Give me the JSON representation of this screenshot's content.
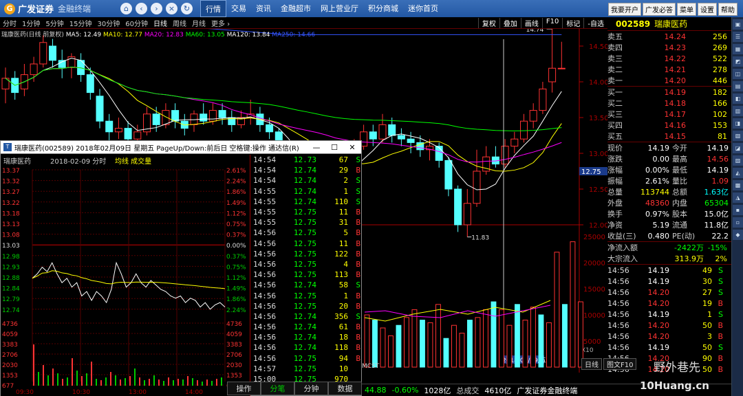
{
  "app": {
    "logo_main": "广发证券",
    "logo_sub": "金融终端"
  },
  "topnav": [
    "行情",
    "交易",
    "资讯",
    "金融超市",
    "网上营业厅",
    "积分商城",
    "迷你首页"
  ],
  "topnav_active": 0,
  "top_right": [
    "我要开户",
    "广发必答",
    "菜单",
    "设置",
    "帮助"
  ],
  "periods": [
    "分时",
    "1分钟",
    "5分钟",
    "15分钟",
    "30分钟",
    "60分钟",
    "日线",
    "周线",
    "月线",
    "更多 ›"
  ],
  "period_active": 6,
  "chart_tools": [
    "复权",
    "叠加",
    "画线",
    "F10",
    "标记",
    "-自选"
  ],
  "stock": {
    "code": "002589",
    "name": "瑞康医药"
  },
  "stock_line": {
    "title": "瑞康医药(日线 前复权)",
    "ma": [
      {
        "label": "MA5: 12.49",
        "color": "#ffffff"
      },
      {
        "label": "MA10: 12.77",
        "color": "#ffff00"
      },
      {
        "label": "MA20: 12.83",
        "color": "#ff00ff"
      },
      {
        "label": "MA60: 13.05",
        "color": "#00ff00"
      },
      {
        "label": "MA120: 13.84",
        "color": "#ffffff"
      },
      {
        "label": "MA250: 14.66",
        "color": "#3355ff"
      }
    ]
  },
  "price_axis": [
    "15.00",
    "14.50",
    "14.00",
    "13.50",
    "13.00",
    "12.50",
    "12.00"
  ],
  "price_current": "12.75",
  "vol_axis": [
    "25000",
    "20000",
    "15000",
    "10000",
    "5000"
  ],
  "annot_high": "14.74",
  "annot_low": "11.83",
  "date_label": "2018/02/09/五",
  "x_tick_2": "2",
  "x10_label": "X10",
  "mcst_label": "MCST",
  "right_bottom_tabs": [
    "日线",
    "图文F10"
  ],
  "quote": {
    "sell": [
      {
        "label": "卖五",
        "price": "14.24",
        "vol": "256"
      },
      {
        "label": "卖四",
        "price": "14.23",
        "vol": "269"
      },
      {
        "label": "卖三",
        "price": "14.22",
        "vol": "522"
      },
      {
        "label": "卖二",
        "price": "14.21",
        "vol": "278"
      },
      {
        "label": "卖一",
        "price": "14.20",
        "vol": "446"
      }
    ],
    "buy": [
      {
        "label": "买一",
        "price": "14.19",
        "vol": "182"
      },
      {
        "label": "买二",
        "price": "14.18",
        "vol": "166"
      },
      {
        "label": "买三",
        "price": "14.17",
        "vol": "102"
      },
      {
        "label": "买四",
        "price": "14.16",
        "vol": "153"
      },
      {
        "label": "买五",
        "price": "14.15",
        "vol": "81"
      }
    ],
    "stats": [
      {
        "l1": "现价",
        "v1": "14.19",
        "c1": "#ffffff",
        "l2": "今开",
        "v2": "14.19",
        "c2": "#ffffff"
      },
      {
        "l1": "涨跌",
        "v1": "0.00",
        "c1": "#ffffff",
        "l2": "最高",
        "v2": "14.56",
        "c2": "#ff3333"
      },
      {
        "l1": "涨幅",
        "v1": "0.00%",
        "c1": "#ffffff",
        "l2": "最低",
        "v2": "14.19",
        "c2": "#ffffff"
      },
      {
        "l1": "振幅",
        "v1": "2.61%",
        "c1": "#ffffff",
        "l2": "量比",
        "v2": "1.09",
        "c2": "#ff3333"
      },
      {
        "l1": "总量",
        "v1": "113744",
        "c1": "#ffff00",
        "l2": "总额",
        "v2": "1.63亿",
        "c2": "#00ffff"
      },
      {
        "l1": "外盘",
        "v1": "48360",
        "c1": "#ff3333",
        "l2": "内盘",
        "v2": "65304",
        "c2": "#00ff00"
      },
      {
        "l1": "换手",
        "v1": "0.97%",
        "c1": "#ffffff",
        "l2": "股本",
        "v2": "15.0亿",
        "c2": "#ffffff"
      },
      {
        "l1": "净资",
        "v1": "5.19",
        "c1": "#ffffff",
        "l2": "流通",
        "v2": "11.8亿",
        "c2": "#ffffff"
      },
      {
        "l1": "收益(三)",
        "v1": "0.480",
        "c1": "#ffffff",
        "l2": "PE(动)",
        "v2": "22.2",
        "c2": "#ffffff"
      }
    ],
    "flow": [
      {
        "label": "净流入额",
        "v": "-2422万",
        "p": "-15%",
        "c": "#00ff00"
      },
      {
        "label": "大宗流入",
        "v": "313.9万",
        "p": "2%",
        "c": "#ffff00"
      }
    ],
    "ticks": [
      {
        "t": "14:56",
        "p": "14.19",
        "v": "49",
        "s": "S",
        "pc": "#ffffff",
        "sc": "#00ff00"
      },
      {
        "t": "14:56",
        "p": "14.19",
        "v": "30",
        "s": "S",
        "pc": "#ffffff",
        "sc": "#00ff00"
      },
      {
        "t": "14:56",
        "p": "14.20",
        "v": "27",
        "s": "S",
        "pc": "#ff3333",
        "sc": "#00ff00"
      },
      {
        "t": "14:56",
        "p": "14.20",
        "v": "19",
        "s": "B",
        "pc": "#ff3333",
        "sc": "#ff3333"
      },
      {
        "t": "14:56",
        "p": "14.19",
        "v": "1",
        "s": "S",
        "pc": "#ffffff",
        "sc": "#00ff00"
      },
      {
        "t": "14:56",
        "p": "14.20",
        "v": "50",
        "s": "B",
        "pc": "#ff3333",
        "sc": "#ff3333"
      },
      {
        "t": "14:56",
        "p": "14.20",
        "v": "3",
        "s": "B",
        "pc": "#ff3333",
        "sc": "#ff3333"
      },
      {
        "t": "14:56",
        "p": "14.19",
        "v": "50",
        "s": "S",
        "pc": "#ffffff",
        "sc": "#00ff00"
      },
      {
        "t": "14:56",
        "p": "14.20",
        "v": "90",
        "s": "B",
        "pc": "#ff3333",
        "sc": "#ff3333"
      },
      {
        "t": "14:56",
        "p": "14.20",
        "v": "50",
        "s": "B",
        "pc": "#ff3333",
        "sc": "#ff3333"
      }
    ]
  },
  "popup": {
    "title": "瑞康医药(002589) 2018年02月09日 星期五 PageUp/Down:前后日 空格键:操作 通达信(R)",
    "sub_name": "瑞康医药",
    "sub_date": "2018-02-09 分时",
    "sub_legend": "均线 成交量",
    "price_labels": [
      "13.37",
      "13.32",
      "13.27",
      "13.22",
      "13.18",
      "13.13",
      "13.08",
      "13.03",
      "12.98",
      "12.93",
      "12.88",
      "12.84",
      "12.79",
      "12.74"
    ],
    "pct_labels": [
      "2.61%",
      "2.24%",
      "1.86%",
      "1.49%",
      "1.12%",
      "0.75%",
      "0.37%",
      "0.00%",
      "0.37%",
      "0.75%",
      "1.12%",
      "1.49%",
      "1.86%",
      "2.24%"
    ],
    "vol_labels": [
      "4736",
      "4059",
      "3383",
      "2706",
      "2030",
      "1353",
      "677"
    ],
    "time_labels": [
      "09:30",
      "10:30",
      "13:00",
      "14:00"
    ],
    "ticks": [
      {
        "t": "14:54",
        "p": "12.73",
        "v": "67",
        "s": "S"
      },
      {
        "t": "14:54",
        "p": "12.74",
        "v": "29",
        "s": "B"
      },
      {
        "t": "14:54",
        "p": "12.74",
        "v": "2",
        "s": "S"
      },
      {
        "t": "14:55",
        "p": "12.74",
        "v": "1",
        "s": "S"
      },
      {
        "t": "14:55",
        "p": "12.74",
        "v": "110",
        "s": "S"
      },
      {
        "t": "14:55",
        "p": "12.75",
        "v": "11",
        "s": "B"
      },
      {
        "t": "14:55",
        "p": "12.75",
        "v": "31",
        "s": "B"
      },
      {
        "t": "14:56",
        "p": "12.75",
        "v": "5",
        "s": "B"
      },
      {
        "t": "14:56",
        "p": "12.75",
        "v": "11",
        "s": "B"
      },
      {
        "t": "14:56",
        "p": "12.75",
        "v": "122",
        "s": "B"
      },
      {
        "t": "14:56",
        "p": "12.75",
        "v": "4",
        "s": "B"
      },
      {
        "t": "14:56",
        "p": "12.75",
        "v": "113",
        "s": "B"
      },
      {
        "t": "14:56",
        "p": "12.74",
        "v": "58",
        "s": "S"
      },
      {
        "t": "14:56",
        "p": "12.75",
        "v": "1",
        "s": "B"
      },
      {
        "t": "14:56",
        "p": "12.75",
        "v": "20",
        "s": "B"
      },
      {
        "t": "14:56",
        "p": "12.74",
        "v": "356",
        "s": "S"
      },
      {
        "t": "14:56",
        "p": "12.74",
        "v": "61",
        "s": "B"
      },
      {
        "t": "14:56",
        "p": "12.74",
        "v": "18",
        "s": "B"
      },
      {
        "t": "14:56",
        "p": "12.74",
        "v": "118",
        "s": "B"
      },
      {
        "t": "14:56",
        "p": "12.75",
        "v": "94",
        "s": "B"
      },
      {
        "t": "14:57",
        "p": "12.75",
        "v": "10",
        "s": ""
      },
      {
        "t": "15:00",
        "p": "12.75",
        "v": "970",
        "s": ""
      }
    ],
    "tabs": [
      "操作",
      "分笔",
      "分钟",
      "数据"
    ],
    "tab_active": 1
  },
  "bottom_bar": {
    "v1": "44.88",
    "v2": "-0.60%",
    "v3": "1028亿",
    "l4": "总成交",
    "v4": "4610亿",
    "broker": "广发证券金融终端"
  },
  "watermark": {
    "t1": "野外巷先",
    "t2": "10Huang.cn"
  },
  "chart_data": {
    "type": "candlestick",
    "days": [
      {
        "o": 13.9,
        "c": 14.05,
        "h": 14.2,
        "l": 13.7
      },
      {
        "o": 14.05,
        "c": 13.85,
        "h": 14.15,
        "l": 13.75
      },
      {
        "o": 13.9,
        "c": 14.1,
        "h": 14.25,
        "l": 13.8
      },
      {
        "o": 14.1,
        "c": 14.25,
        "h": 14.35,
        "l": 14.0
      },
      {
        "o": 14.25,
        "c": 14.55,
        "h": 14.65,
        "l": 14.2
      },
      {
        "o": 14.5,
        "c": 14.3,
        "h": 14.6,
        "l": 14.2
      },
      {
        "o": 14.3,
        "c": 14.2,
        "h": 14.45,
        "l": 14.05
      },
      {
        "o": 14.2,
        "c": 14.35,
        "h": 14.4,
        "l": 14.05
      },
      {
        "o": 14.3,
        "c": 14.1,
        "h": 14.4,
        "l": 14.0
      },
      {
        "o": 14.1,
        "c": 13.85,
        "h": 14.2,
        "l": 13.75
      },
      {
        "o": 13.8,
        "c": 13.45,
        "h": 13.9,
        "l": 13.35
      },
      {
        "o": 13.45,
        "c": 13.3,
        "h": 13.55,
        "l": 13.15
      },
      {
        "o": 13.3,
        "c": 13.35,
        "h": 13.5,
        "l": 13.2
      },
      {
        "o": 13.35,
        "c": 13.2,
        "h": 13.45,
        "l": 13.1
      },
      {
        "o": 13.2,
        "c": 13.3,
        "h": 13.4,
        "l": 13.1
      },
      {
        "o": 13.3,
        "c": 13.55,
        "h": 13.65,
        "l": 13.25
      },
      {
        "o": 13.55,
        "c": 13.4,
        "h": 13.65,
        "l": 13.3
      },
      {
        "o": 13.4,
        "c": 13.6,
        "h": 13.7,
        "l": 13.35
      },
      {
        "o": 13.6,
        "c": 13.45,
        "h": 13.7,
        "l": 13.35
      },
      {
        "o": 13.45,
        "c": 13.35,
        "h": 13.55,
        "l": 13.25
      },
      {
        "o": 13.4,
        "c": 13.55,
        "h": 13.6,
        "l": 13.3
      },
      {
        "o": 13.55,
        "c": 13.45,
        "h": 13.7,
        "l": 13.4
      },
      {
        "o": 13.45,
        "c": 13.6,
        "h": 13.7,
        "l": 13.4
      },
      {
        "o": 13.6,
        "c": 13.5,
        "h": 13.7,
        "l": 13.4
      },
      {
        "o": 13.5,
        "c": 13.4,
        "h": 13.6,
        "l": 13.3
      },
      {
        "o": 13.4,
        "c": 13.5,
        "h": 13.6,
        "l": 13.35
      },
      {
        "o": 13.5,
        "c": 13.55,
        "h": 13.75,
        "l": 13.4
      },
      {
        "o": 13.55,
        "c": 13.4,
        "h": 13.65,
        "l": 13.3
      },
      {
        "o": 13.4,
        "c": 13.3,
        "h": 13.5,
        "l": 13.2
      },
      {
        "o": 13.3,
        "c": 13.0,
        "h": 13.35,
        "l": 12.95
      },
      {
        "o": 13.0,
        "c": 12.8,
        "h": 13.05,
        "l": 12.7
      },
      {
        "o": 12.8,
        "c": 12.7,
        "h": 12.9,
        "l": 12.6
      },
      {
        "o": 12.7,
        "c": 12.8,
        "h": 12.9,
        "l": 12.65
      },
      {
        "o": 12.8,
        "c": 12.65,
        "h": 12.85,
        "l": 12.55
      },
      {
        "o": 12.65,
        "c": 12.6,
        "h": 12.75,
        "l": 12.5
      },
      {
        "o": 12.6,
        "c": 12.7,
        "h": 12.8,
        "l": 12.55
      },
      {
        "o": 12.7,
        "c": 12.9,
        "h": 13.0,
        "l": 12.65
      },
      {
        "o": 12.9,
        "c": 13.1,
        "h": 13.2,
        "l": 12.85
      },
      {
        "o": 13.1,
        "c": 13.3,
        "h": 13.4,
        "l": 13.05
      },
      {
        "o": 13.3,
        "c": 13.2,
        "h": 13.4,
        "l": 13.1
      },
      {
        "o": 13.2,
        "c": 13.4,
        "h": 13.55,
        "l": 13.15
      },
      {
        "o": 13.4,
        "c": 13.25,
        "h": 13.5,
        "l": 13.15
      },
      {
        "o": 13.25,
        "c": 13.2,
        "h": 13.35,
        "l": 13.1
      },
      {
        "o": 13.2,
        "c": 13.15,
        "h": 13.3,
        "l": 13.0
      },
      {
        "o": 13.15,
        "c": 13.05,
        "h": 13.25,
        "l": 12.95
      },
      {
        "o": 13.05,
        "c": 13.1,
        "h": 13.2,
        "l": 12.9
      },
      {
        "o": 13.1,
        "c": 12.9,
        "h": 13.15,
        "l": 12.8
      },
      {
        "o": 12.9,
        "c": 12.5,
        "h": 12.95,
        "l": 12.4
      },
      {
        "o": 12.5,
        "c": 12.0,
        "h": 12.55,
        "l": 11.9
      },
      {
        "o": 12.0,
        "c": 12.3,
        "h": 12.5,
        "l": 11.83
      },
      {
        "o": 12.3,
        "c": 12.75,
        "h": 13.05,
        "l": 12.25
      },
      {
        "o": 12.75,
        "c": 12.95,
        "h": 13.1,
        "l": 12.7
      },
      {
        "o": 12.95,
        "c": 12.85,
        "h": 13.1,
        "l": 12.8
      },
      {
        "o": 12.85,
        "c": 13.1,
        "h": 13.2,
        "l": 12.8
      },
      {
        "o": 13.1,
        "c": 13.2,
        "h": 13.3,
        "l": 13.0
      },
      {
        "o": 13.2,
        "c": 13.45,
        "h": 13.55,
        "l": 13.15
      },
      {
        "o": 13.45,
        "c": 13.6,
        "h": 13.7,
        "l": 13.35
      },
      {
        "o": 13.6,
        "c": 13.9,
        "h": 14.0,
        "l": 13.55
      },
      {
        "o": 14.0,
        "c": 14.19,
        "h": 14.74,
        "l": 13.85
      },
      {
        "o": 14.19,
        "c": 14.19,
        "h": 14.56,
        "l": 14.19
      }
    ],
    "ma250": [
      14.96,
      14.95,
      14.94,
      14.93,
      14.92,
      14.91,
      14.9,
      14.89,
      14.88,
      14.87,
      14.86,
      14.85,
      14.84,
      14.83,
      14.82,
      14.81,
      14.8,
      14.79,
      14.78,
      14.77,
      14.76,
      14.75,
      14.74,
      14.73,
      14.72,
      14.71,
      14.7,
      14.69,
      14.68,
      14.67,
      14.66,
      14.66,
      14.66,
      14.66,
      14.66,
      14.66,
      14.66,
      14.66,
      14.66,
      14.66,
      14.66,
      14.66,
      14.66,
      14.66,
      14.66,
      14.66,
      14.66,
      14.66,
      14.66,
      14.66,
      14.66,
      14.66,
      14.66,
      14.66,
      14.66,
      14.66,
      14.66,
      14.66,
      14.66,
      14.66
    ],
    "vol_ylim": [
      0,
      25000
    ],
    "volume": [
      0,
      0,
      0,
      0,
      0,
      0,
      0,
      0,
      0,
      0,
      0,
      0,
      0,
      0,
      0,
      0,
      0,
      0,
      0,
      0,
      0,
      0,
      0,
      0,
      0,
      0,
      0,
      0,
      0,
      0,
      0,
      0,
      0,
      0,
      0,
      0,
      0,
      0,
      0,
      0,
      0,
      0,
      0,
      0,
      0,
      0,
      0,
      0,
      0,
      0,
      0,
      0,
      10000,
      9000,
      7500,
      6000,
      8000,
      9500,
      11000,
      9000,
      8500,
      12000,
      5500,
      8000,
      6500,
      9000,
      9500,
      11000,
      12500,
      11000,
      8000,
      12000,
      9000,
      11500,
      10000,
      8500,
      22000,
      12000,
      24000,
      12500
    ]
  }
}
